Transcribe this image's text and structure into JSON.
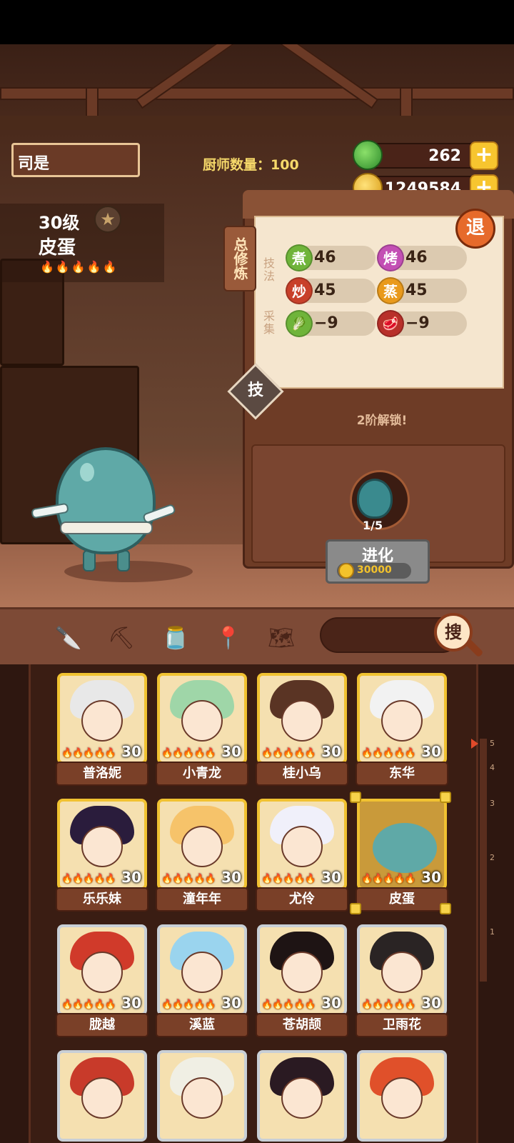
{
  "header": {
    "player_name": "司是",
    "chef_count_label": "厨师数量：100"
  },
  "currency": {
    "jade": {
      "icon": "jade-icon",
      "value": "262",
      "add": "+"
    },
    "coins": {
      "icon": "coin-icon",
      "value": "1249584",
      "add": "+"
    }
  },
  "chef": {
    "level": "30级",
    "name": "皮蛋",
    "flames": "🔥🔥🔥🔥🔥"
  },
  "training": {
    "tab_label": "总修炼",
    "exit_label": "退",
    "technique_label": "技法",
    "gather_label": "采集",
    "stats": [
      {
        "badge": "煮",
        "value": "46",
        "color": "#6fb43a"
      },
      {
        "badge": "烤",
        "value": "46",
        "color": "#c34fb4"
      },
      {
        "badge": "炒",
        "value": "45",
        "color": "#c8402a"
      },
      {
        "badge": "蒸",
        "value": "45",
        "color": "#e99a1c"
      },
      {
        "badge": "veg",
        "value": "−9",
        "color": "#6fb43a"
      },
      {
        "badge": "meat",
        "value": "−9",
        "color": "#b8302a"
      }
    ],
    "skill_label": "技",
    "unlock_text": "2阶解锁!",
    "evolve": {
      "progress": "1/5",
      "label": "进化",
      "cost": "30000"
    }
  },
  "search": {
    "label": "搜"
  },
  "chefs": [
    {
      "name": "普洛妮",
      "level": "30",
      "hair": "#e8e8e8"
    },
    {
      "name": "小青龙",
      "level": "30",
      "hair": "#9fd6a8"
    },
    {
      "name": "桂小乌",
      "level": "30",
      "hair": "#5a3424"
    },
    {
      "name": "东华",
      "level": "30",
      "hair": "#f2f2f2"
    },
    {
      "name": "乐乐妹",
      "level": "30",
      "hair": "#2a1c3c"
    },
    {
      "name": "潼年年",
      "level": "30",
      "hair": "#f6c36a"
    },
    {
      "name": "尤伶",
      "level": "30",
      "hair": "#f0f0fa"
    },
    {
      "name": "皮蛋",
      "level": "30",
      "hair": "#5fa9a7"
    },
    {
      "name": "胧越",
      "level": "30",
      "hair": "#d03a2a"
    },
    {
      "name": "溪蓝",
      "level": "30",
      "hair": "#9ad4ee"
    },
    {
      "name": "苍胡颉",
      "level": "30",
      "hair": "#1e1414"
    },
    {
      "name": "卫雨花",
      "level": "30",
      "hair": "#2a2424"
    },
    {
      "name": "",
      "level": "",
      "hair": "#c83a2a"
    },
    {
      "name": "",
      "level": "",
      "hair": "#f0efe4"
    },
    {
      "name": "",
      "level": "",
      "hair": "#2a1a22"
    },
    {
      "name": "",
      "level": "",
      "hair": "#e0502a"
    }
  ],
  "rank_scale": [
    "5",
    "4",
    "3",
    "2",
    "1"
  ]
}
